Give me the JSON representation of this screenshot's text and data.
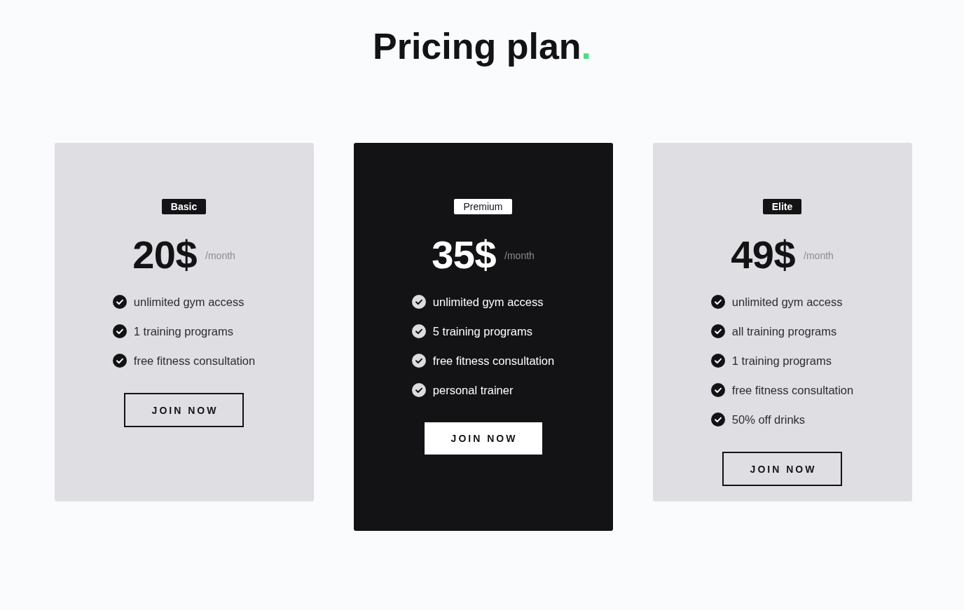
{
  "title": "Pricing plan",
  "title_mark": ".",
  "plans": [
    {
      "name": "Basic",
      "featured": false,
      "price": "20$",
      "period": "/month",
      "features": [
        "unlimited gym access",
        "1 training programs",
        "free fitness consultation"
      ],
      "button": "JOIN NOW"
    },
    {
      "name": "Premium",
      "featured": true,
      "price": "35$",
      "period": "/month",
      "features": [
        "unlimited gym access",
        "5 training programs",
        "free fitness consultation",
        "personal trainer"
      ],
      "button": "JOIN NOW"
    },
    {
      "name": "Elite",
      "featured": false,
      "price": "49$",
      "period": "/month",
      "features": [
        "unlimited gym access",
        "all training programs",
        "1 training programs",
        "free fitness consultation",
        "50% off drinks"
      ],
      "button": "JOIN NOW"
    }
  ]
}
